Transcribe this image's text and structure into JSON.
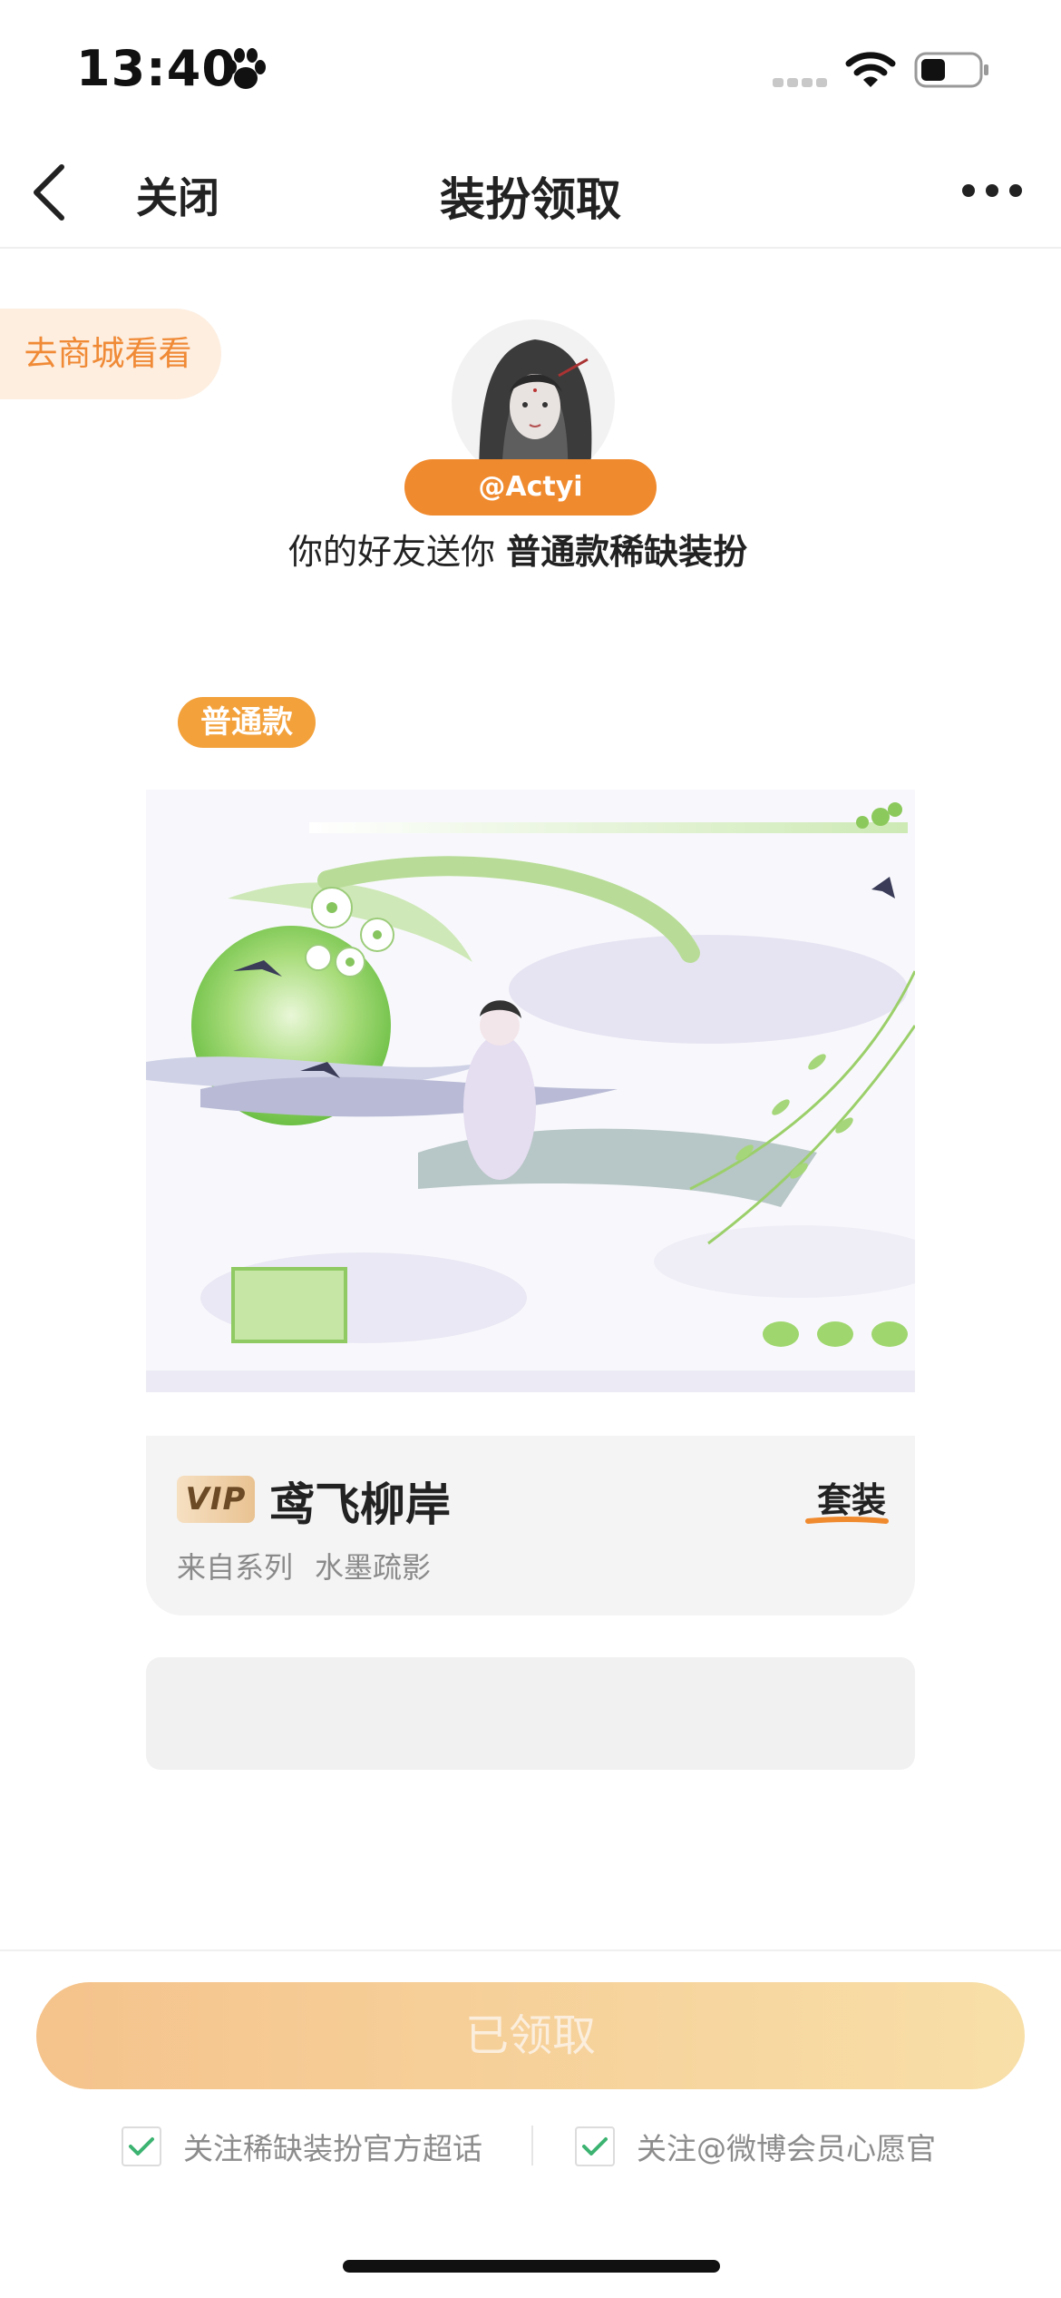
{
  "status_bar": {
    "time": "13:40",
    "icons": [
      "paw-icon",
      "signal-icon",
      "wifi-icon",
      "battery-icon"
    ]
  },
  "nav": {
    "back_icon": "chevron-left-icon",
    "close_label": "关闭",
    "title": "装扮领取",
    "more_icon": "more-horizontal-icon"
  },
  "store_link": "去商城看看",
  "sender": {
    "handle": "@Actyi",
    "message_prefix": "你的好友送你 ",
    "message_item": "普通款稀缺装扮"
  },
  "tier_badge": "普通款",
  "item": {
    "vip_badge": "VIP",
    "name": "鸢飞柳岸",
    "type": "套装",
    "series_label": "来自系列",
    "series_name": "水墨疏影"
  },
  "claim_button": "已领取",
  "follows": [
    {
      "label": "关注稀缺装扮官方超话",
      "checked": true
    },
    {
      "label": "关注@微博会员心愿官",
      "checked": true
    }
  ],
  "colors": {
    "accent_orange": "#f08a2e",
    "badge_orange": "#f3a13b",
    "check_green": "#3cb371",
    "pill_bg": "#fdeee0"
  }
}
